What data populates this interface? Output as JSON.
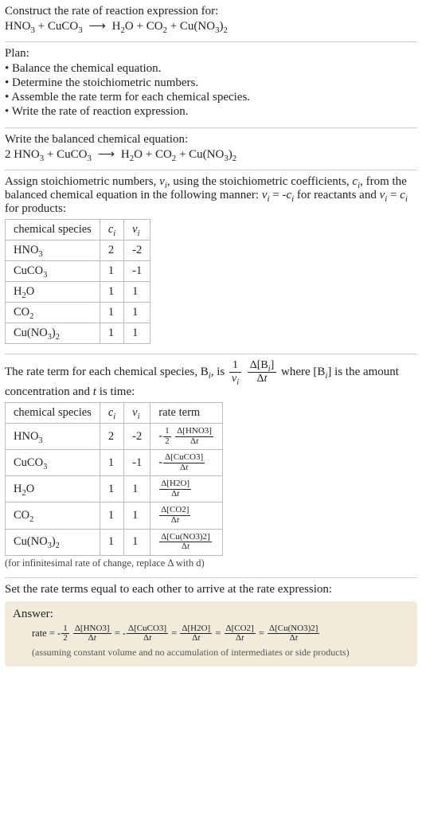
{
  "sec1": {
    "prompt_line1": "Construct the rate of reaction expression for:",
    "eq_lhs1": "HNO",
    "eq_lhs1_sub": "3",
    "plus": " + ",
    "eq_lhs2": "CuCO",
    "eq_lhs2_sub": "3",
    "arrow": "⟶",
    "eq_rhs1": "H",
    "eq_rhs1_sub": "2",
    "eq_rhs1b": "O",
    "eq_rhs2": "CO",
    "eq_rhs2_sub": "2",
    "eq_rhs3": "Cu(NO",
    "eq_rhs3_sub": "3",
    "eq_rhs3b": ")",
    "eq_rhs3_sub2": "2"
  },
  "plan": {
    "title": "Plan:",
    "items": [
      "Balance the chemical equation.",
      "Determine the stoichiometric numbers.",
      "Assemble the rate term for each chemical species.",
      "Write the rate of reaction expression."
    ]
  },
  "balanced": {
    "title": "Write the balanced chemical equation:",
    "coef1": "2 ",
    "sp1": "HNO",
    "sp1_sub": "3",
    "sp2": "CuCO",
    "sp2_sub": "3",
    "sp3a": "H",
    "sp3sub": "2",
    "sp3b": "O",
    "sp4": "CO",
    "sp4_sub": "2",
    "sp5a": "Cu(NO",
    "sp5sub": "3",
    "sp5b": ")",
    "sp5sub2": "2"
  },
  "assign": {
    "text1": "Assign stoichiometric numbers, ",
    "nu": "ν",
    "sub_i": "i",
    "text2": ", using the stoichiometric coefficients, ",
    "c": "c",
    "text3": ", from the balanced chemical equation in the following manner: ",
    "rel_react": " = -",
    "text_react": " for reactants and ",
    "rel_prod": " = ",
    "text_prod": " for products:",
    "tbl": {
      "h1": "chemical species",
      "h2": "cᵢ",
      "h3": "νᵢ",
      "rows": [
        {
          "sp": "HNO",
          "sub": "3",
          "c": "2",
          "nu": "-2"
        },
        {
          "sp": "CuCO",
          "sub": "3",
          "c": "1",
          "nu": "-1"
        },
        {
          "sp": "H",
          "sub": "2",
          "spb": "O",
          "c": "1",
          "nu": "1"
        },
        {
          "sp": "CO",
          "sub": "2",
          "c": "1",
          "nu": "1"
        },
        {
          "sp": "Cu(NO",
          "sub": "3",
          "spb": ")",
          "sub2": "2",
          "c": "1",
          "nu": "1"
        }
      ]
    }
  },
  "rateterm": {
    "text1": "The rate term for each chemical species, B",
    "text2": ", is ",
    "big_num": "1",
    "big_den_nu": "ν",
    "delta": "Δ",
    "conc": "[B",
    "conc_close": "]",
    "dt": "t",
    "text3": " where [B",
    "text4": "] is the amount concentration and ",
    "t": "t",
    "text5": " is time:",
    "tbl": {
      "h1": "chemical species",
      "h2": "cᵢ",
      "h3": "νᵢ",
      "h4": "rate term",
      "rows": [
        {
          "sp": "HNO",
          "sub": "3",
          "c": "2",
          "nu": "-2",
          "pre": "-",
          "fnum": "1",
          "fden": "2",
          "dnum": "Δ[HNO3]",
          "dden": "Δt"
        },
        {
          "sp": "CuCO",
          "sub": "3",
          "c": "1",
          "nu": "-1",
          "pre": "-",
          "dnum": "Δ[CuCO3]",
          "dden": "Δt"
        },
        {
          "sp": "H",
          "sub": "2",
          "spb": "O",
          "c": "1",
          "nu": "1",
          "dnum": "Δ[H2O]",
          "dden": "Δt"
        },
        {
          "sp": "CO",
          "sub": "2",
          "c": "1",
          "nu": "1",
          "dnum": "Δ[CO2]",
          "dden": "Δt"
        },
        {
          "sp": "Cu(NO",
          "sub": "3",
          "spb": ")",
          "sub2": "2",
          "c": "1",
          "nu": "1",
          "dnum": "Δ[Cu(NO3)2]",
          "dden": "Δt"
        }
      ]
    },
    "note": "(for infinitesimal rate of change, replace Δ with d)"
  },
  "final": {
    "title": "Set the rate terms equal to each other to arrive at the rate expression:",
    "answer_label": "Answer:",
    "rate_word": "rate = ",
    "neg": "-",
    "half_num": "1",
    "half_den": "2",
    "t1_num": "Δ[HNO3]",
    "t1_den": "Δt",
    "eq": " = ",
    "t2_num": "Δ[CuCO3]",
    "t2_den": "Δt",
    "t3_num": "Δ[H2O]",
    "t3_den": "Δt",
    "t4_num": "Δ[CO2]",
    "t4_den": "Δt",
    "t5_num": "Δ[Cu(NO3)2]",
    "t5_den": "Δt",
    "note": "(assuming constant volume and no accumulation of intermediates or side products)"
  }
}
